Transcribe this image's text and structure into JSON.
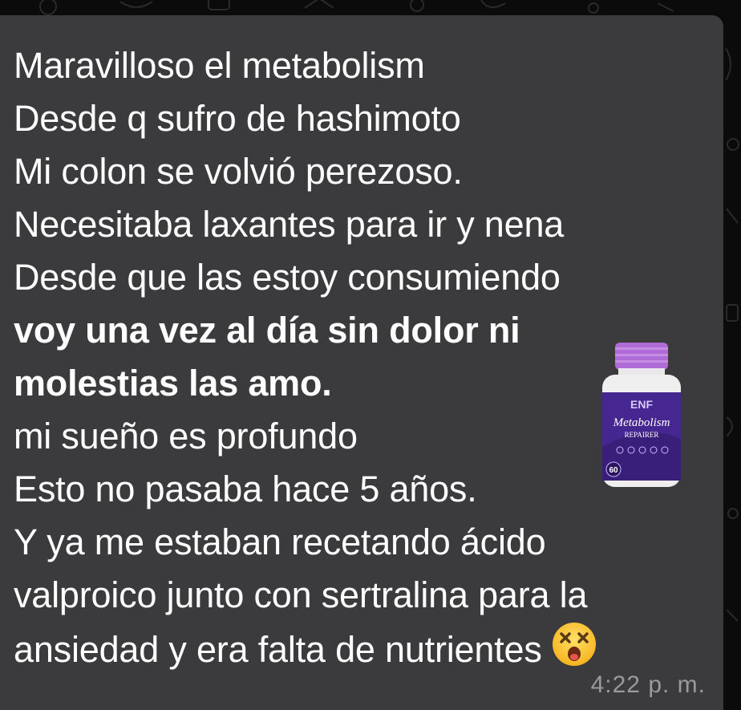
{
  "message": {
    "lines": [
      {
        "text": "Maravilloso el metabolism",
        "bold": false
      },
      {
        "text": "Desde q sufro de hashimoto",
        "bold": false
      },
      {
        "text": "Mi colon se volvió perezoso.",
        "bold": false
      },
      {
        "text": "Necesitaba laxantes para ir y nena",
        "bold": false
      },
      {
        "text": "Desde que las estoy consumiendo",
        "bold": false
      },
      {
        "text": "voy una vez al día sin dolor ni",
        "bold": true
      },
      {
        "text": "molestias las amo.",
        "bold": true
      },
      {
        "text": "mi sueño es profundo",
        "bold": false
      },
      {
        "text": "Esto no pasaba hace 5 años.",
        "bold": false
      },
      {
        "text": "Y ya me estaban recetando ácido",
        "bold": false
      },
      {
        "text": "valproico junto con sertralina para la",
        "bold": false
      },
      {
        "text": "ansiedad y era falta de nutrientes",
        "bold": false
      }
    ],
    "emoji": "dizzy-face-emoji",
    "timestamp": "4:22 p. m."
  },
  "product_image": {
    "brand": "ENF",
    "name": "Metabolism",
    "subname": "REPAIRER",
    "count": "60"
  },
  "colors": {
    "background": "#0b0b0b",
    "bubble": "#3b3b3d",
    "text": "#ffffff",
    "timestamp": "#9a9a9d",
    "bottle_cap": "#b06cd6",
    "bottle_label": "#3a1f7a"
  }
}
